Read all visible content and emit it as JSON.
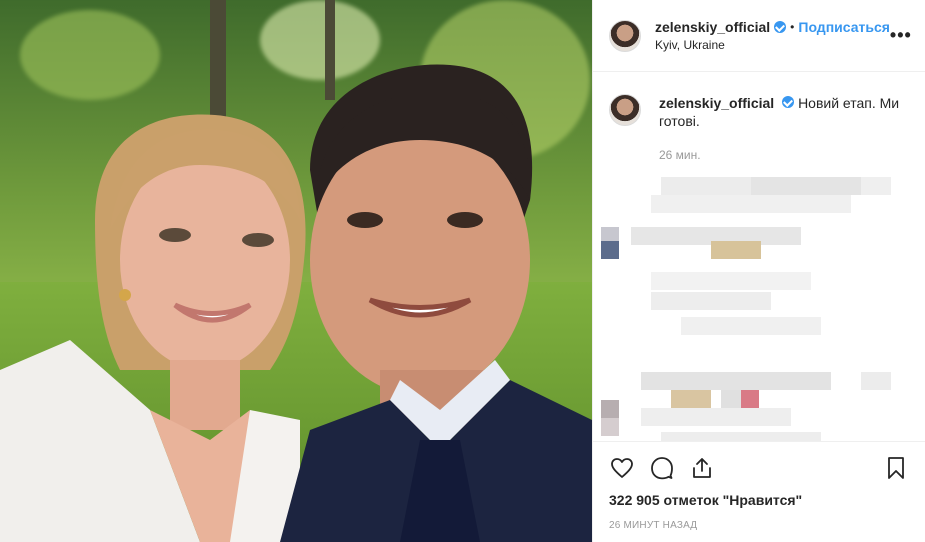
{
  "header": {
    "username": "zelenskiy_official",
    "separator": "•",
    "follow_label": "Подписаться",
    "location": "Kyiv, Ukraine",
    "more_label": "•••",
    "verified_icon": "verified-badge-icon"
  },
  "caption": {
    "username": "zelenskiy_official",
    "text": "Новий етап. Ми готові.",
    "time": "26 мин."
  },
  "actions": {
    "icons": [
      "heart-icon",
      "comment-icon",
      "share-icon",
      "bookmark-icon"
    ],
    "likes": "322 905 отметок \"Нравится\"",
    "posted": "26 МИНУТ НАЗАД"
  },
  "colors": {
    "accent": "#3897f0",
    "text": "#262626",
    "muted": "#999999",
    "border": "#efefef"
  }
}
